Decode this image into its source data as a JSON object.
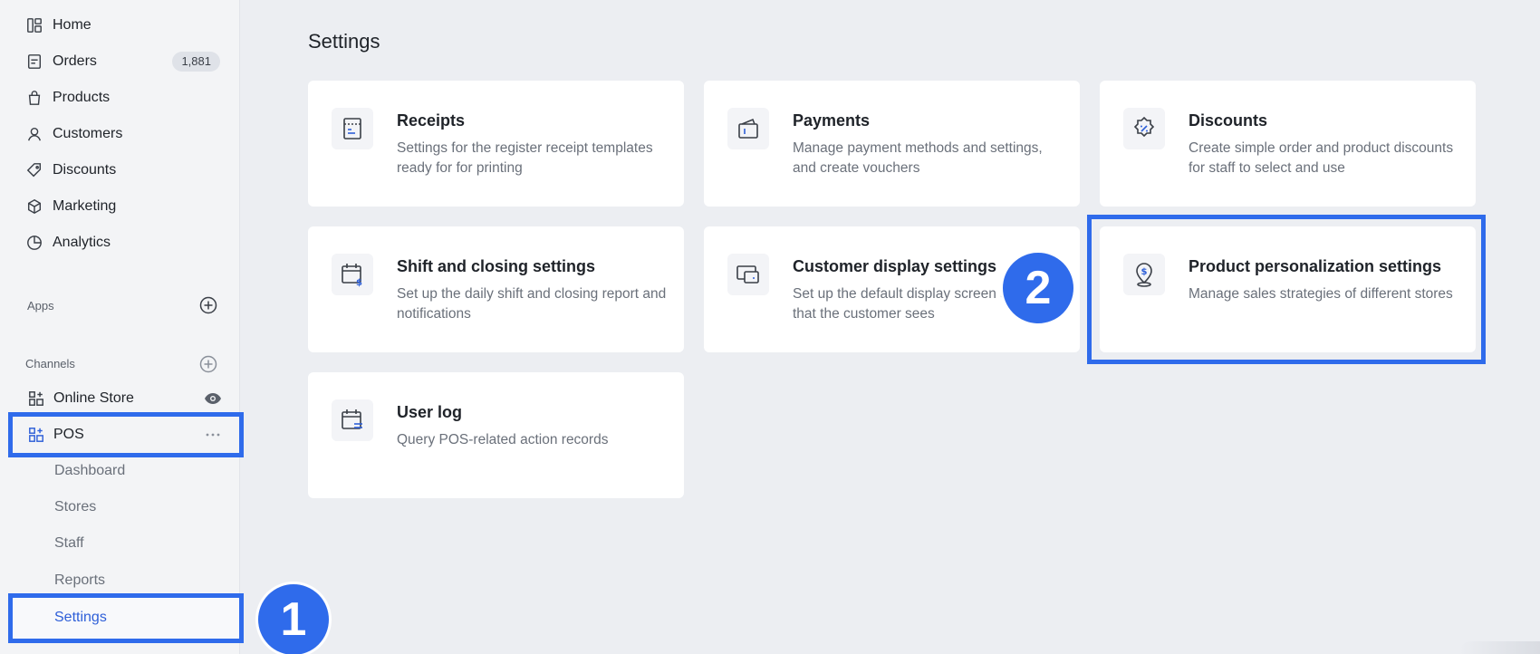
{
  "sidebar": {
    "nav": [
      {
        "label": "Home",
        "icon": "home-icon"
      },
      {
        "label": "Orders",
        "icon": "orders-icon",
        "badge": "1,881"
      },
      {
        "label": "Products",
        "icon": "products-bag-icon"
      },
      {
        "label": "Customers",
        "icon": "customer-person-icon"
      },
      {
        "label": "Discounts",
        "icon": "tag-icon"
      },
      {
        "label": "Marketing",
        "icon": "cube-icon"
      },
      {
        "label": "Analytics",
        "icon": "pie-chart-icon"
      }
    ],
    "apps_label": "Apps",
    "channels_label": "Channels",
    "channels": [
      {
        "label": "Online Store",
        "icon": "grid-plus-icon",
        "right_icon": "eye-icon"
      },
      {
        "label": "POS",
        "icon": "grid-plus-icon",
        "right_icon": "more-dots-icon"
      }
    ],
    "pos_sub": [
      {
        "label": "Dashboard"
      },
      {
        "label": "Stores"
      },
      {
        "label": "Staff"
      },
      {
        "label": "Reports"
      },
      {
        "label": "Settings",
        "active": true
      }
    ]
  },
  "main": {
    "title": "Settings",
    "cards": [
      {
        "title": "Receipts",
        "desc": "Settings for the register receipt templates ready for for printing",
        "icon": "receipt-icon"
      },
      {
        "title": "Payments",
        "desc": "Manage payment methods and settings, and create vouchers",
        "icon": "wallet-icon"
      },
      {
        "title": "Discounts",
        "desc": "Create simple order and product discounts for staff to select and use",
        "icon": "discount-badge-icon"
      },
      {
        "title": "Shift and closing settings",
        "desc": "Set up the daily shift and closing report and notifications",
        "icon": "calendar-dollar-icon"
      },
      {
        "title": "Customer display settings",
        "desc": "Set up the default display screen settings that the customer sees",
        "icon": "display-screen-icon"
      },
      {
        "title": "Product personalization settings",
        "desc": "Manage sales strategies of different stores",
        "icon": "location-dollar-icon"
      },
      {
        "title": "User log",
        "desc": "Query POS-related action records",
        "icon": "calendar-log-icon"
      }
    ]
  },
  "annotations": {
    "step1": "1",
    "step2": "2",
    "color": "#2F6BEB"
  },
  "colors": {
    "accent": "#2E5FD8",
    "background": "#ECEEF2",
    "card": "#FFFFFF"
  }
}
